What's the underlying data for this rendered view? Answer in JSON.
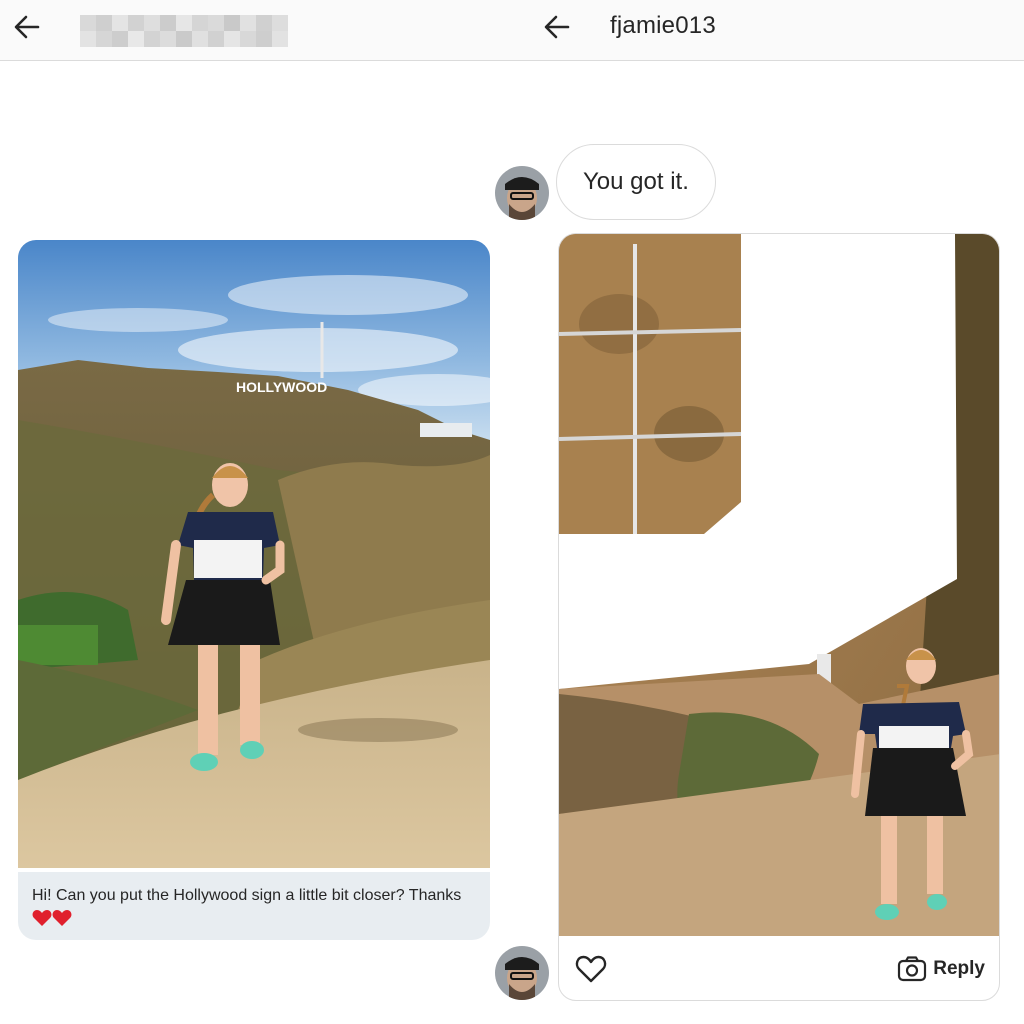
{
  "left_header": {
    "title_redacted": true
  },
  "right_header": {
    "username": "fjamie013"
  },
  "left_message": {
    "text": "Hi! Can you put the Hollywood sign a little bit closer? Thanks"
  },
  "left_photo": {
    "sign_text": "HOLLYWOOD"
  },
  "right_chat": {
    "reply_bubble": "You got it.",
    "reply_button_label": "Reply"
  },
  "icons": {
    "back": "arrow-left-icon",
    "like": "heart-outline-icon",
    "camera": "camera-icon",
    "heart_emoji": "red-heart-emoji"
  },
  "colors": {
    "header_bg": "#fafafa",
    "message_bg": "#e8edf1",
    "heart_red": "#e0202d",
    "text": "#262626"
  }
}
